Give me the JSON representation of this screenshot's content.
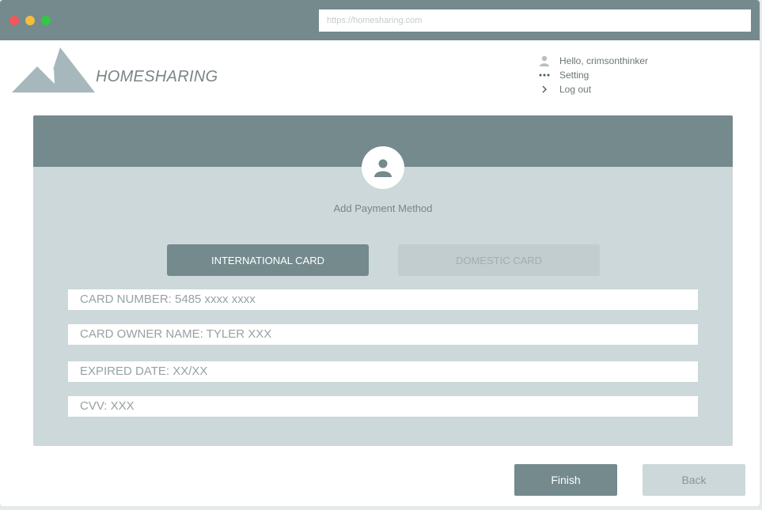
{
  "browser": {
    "url": "https://homesharing.com"
  },
  "header": {
    "brand": "HOMESHARING",
    "menu": [
      {
        "icon": "user-icon",
        "label": "Hello, crimsonthinker"
      },
      {
        "icon": "more-icon",
        "label": "Setting"
      },
      {
        "icon": "chevron-right-icon",
        "label": "Log out"
      }
    ]
  },
  "panel": {
    "title": "Add Payment Method",
    "tabs": [
      {
        "label": "INTERNATIONAL CARD",
        "active": true
      },
      {
        "label": "DOMESTIC CARD",
        "active": false
      }
    ],
    "fields": [
      {
        "text": "CARD NUMBER: 5485 xxxx xxxx"
      },
      {
        "text": "CARD OWNER NAME: TYLER XXX"
      },
      {
        "text": "EXPIRED DATE: XX/XX"
      },
      {
        "text": "CVV: XXX"
      }
    ]
  },
  "actions": {
    "finish": "Finish",
    "back": "Back"
  },
  "colors": {
    "primary": "#748a8d",
    "panel": "#ccd8d9",
    "logo": "#a7b8bc"
  }
}
